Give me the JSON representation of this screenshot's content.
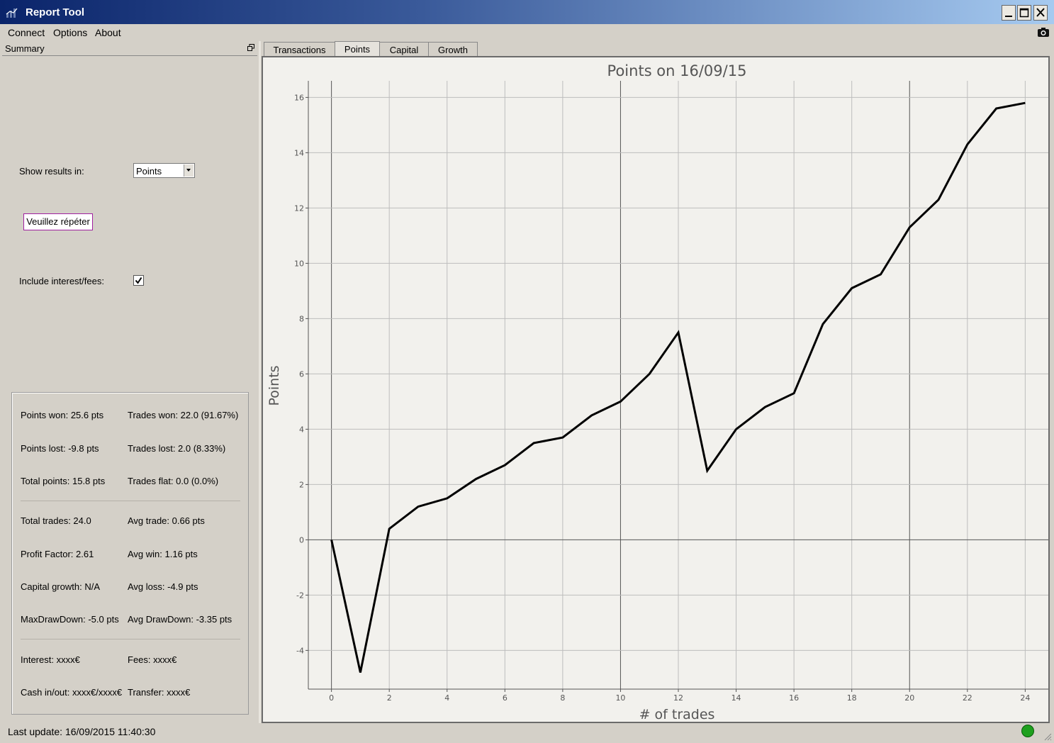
{
  "window": {
    "title": "Report Tool"
  },
  "menu": [
    "Connect",
    "Options",
    "About"
  ],
  "sidebar": {
    "title": "Summary",
    "show_results_label": "Show results in:",
    "show_results_value": "Points",
    "repeat_button": "Veuillez répéter",
    "include_label": "Include interest/fees:",
    "include_checked": true,
    "stats": [
      {
        "left": "Points won: 25.6 pts",
        "right": "Trades won: 22.0 (91.67%)"
      },
      {
        "left": "Points lost: -9.8 pts",
        "right": "Trades lost: 2.0 (8.33%)"
      },
      {
        "left": "Total points: 15.8 pts",
        "right": "Trades flat: 0.0 (0.0%)"
      },
      {
        "left": "Total trades: 24.0",
        "right": "Avg trade: 0.66 pts"
      },
      {
        "left": "Profit Factor: 2.61",
        "right": "Avg win: 1.16 pts"
      },
      {
        "left": "Capital growth: N/A",
        "right": "Avg loss: -4.9 pts"
      },
      {
        "left": "MaxDrawDown: -5.0 pts",
        "right": "Avg DrawDown: -3.35 pts"
      },
      {
        "left": "Interest: xxxx€",
        "right": "Fees: xxxx€"
      },
      {
        "left": "Cash in/out: xxxx€/xxxx€",
        "right": "Transfer: xxxx€"
      }
    ]
  },
  "tabs": [
    "Transactions",
    "Points",
    "Capital",
    "Growth"
  ],
  "active_tab": "Points",
  "status": {
    "text": "Last update: 16/09/2015 11:40:30",
    "indicator_color": "#1ea01e"
  },
  "chart_data": {
    "type": "line",
    "title": "Points on 16/09/15",
    "xlabel": "# of trades",
    "ylabel": "Points",
    "xlim": [
      -0.8,
      24.8
    ],
    "ylim": [
      -5.4,
      16.6
    ],
    "xticks": [
      0,
      2,
      4,
      6,
      8,
      10,
      12,
      14,
      16,
      18,
      20,
      22,
      24
    ],
    "yticks": [
      -4,
      -2,
      0,
      2,
      4,
      6,
      8,
      10,
      12,
      14,
      16
    ],
    "grid": true,
    "series": [
      {
        "x": [
          0,
          1,
          2,
          3,
          4,
          5,
          6,
          7,
          8,
          9,
          10,
          11,
          12,
          13,
          14,
          15,
          16,
          17,
          18,
          19,
          20,
          21,
          22,
          23,
          24
        ],
        "y": [
          0,
          -4.8,
          0.4,
          1.2,
          1.5,
          2.2,
          2.7,
          3.5,
          3.7,
          4.5,
          5.0,
          6.0,
          7.5,
          2.5,
          4.0,
          4.8,
          5.3,
          7.8,
          9.1,
          9.6,
          11.3,
          12.3,
          14.3,
          15.6,
          15.8
        ],
        "color": "#000000"
      }
    ]
  }
}
